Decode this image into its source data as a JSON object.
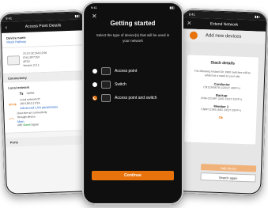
{
  "left": {
    "status_time": "9:41",
    "title": "Access Point Details",
    "device_name_label": "Device name",
    "device_name_value": "Mesh Hallway",
    "mac": "7C:57:3C:D4:C2:56",
    "model": "CNL10F715V",
    "ap": "AP15",
    "version": "Version 2.5.1",
    "connectivity_label": "Connectivity",
    "local_network_label": "Local network",
    "uplink": "Uplink",
    "local_ip_label": "Local network IP",
    "local_ip_value": "192.168.0.17/24",
    "advanced_lan": "Advanced LAN parameters",
    "over_air_1": "Over-the-air connectivity",
    "over_air_2": "through device",
    "over_air_device": "Main",
    "over_air_signal_pre": "with",
    "over_air_signal": "Good",
    "over_air_signal_post": "signal",
    "ports_label": "Ports"
  },
  "center": {
    "status_time": "9:41",
    "title": "Getting started",
    "subtitle": "Select the type of device(s) that will be used in your network",
    "options": [
      "Access point",
      "Switch",
      "Access point and switch"
    ],
    "continue_label": "Continue"
  },
  "right": {
    "status_time": "9:41",
    "title": "Extend Network",
    "header": "Add new devices",
    "card_title": "Stack details",
    "card_text": "The following Instant On 1960 switches will be added as a stack to your site",
    "conductor_label": "Conductor",
    "conductor_value": "CN12345678 (12XGT 4SFP+)",
    "backup_label": "Backup",
    "backup_value": "CN9+221987 (24G 2XGT 2SFP+)",
    "member_label": "Member 1",
    "member_value": "CN9P12345 (48G 2XGT 2SFP+)",
    "ok_label": "Ok",
    "add_device": "Add device",
    "search_again": "Search again"
  },
  "colors": {
    "accent": "#e8730c",
    "link": "#2f6dcc",
    "good": "#3aa14a"
  }
}
